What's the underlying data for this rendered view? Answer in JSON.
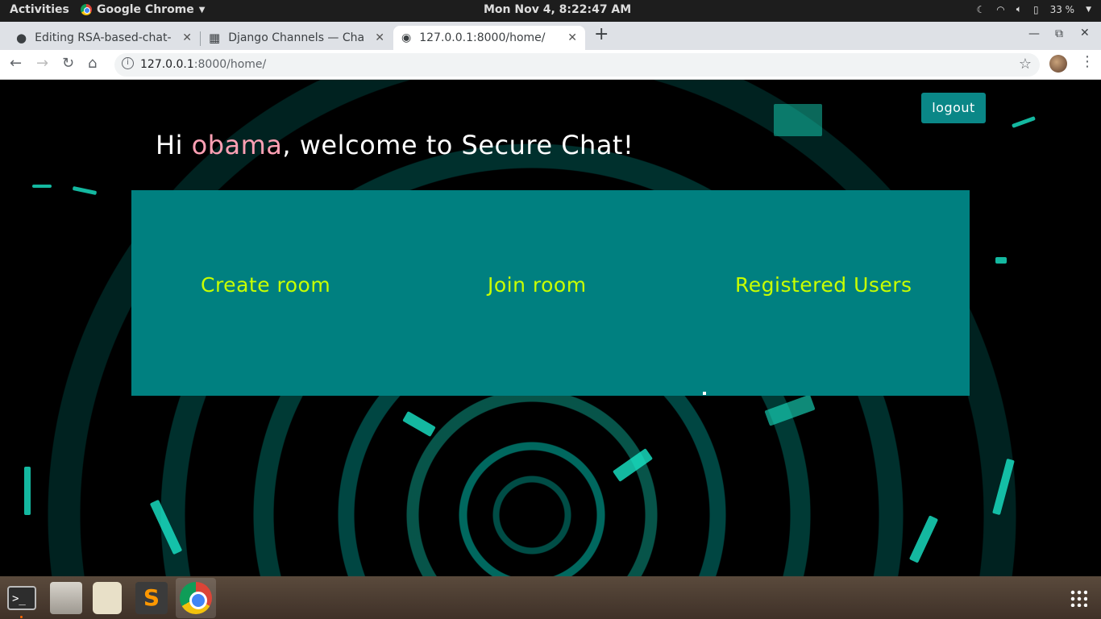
{
  "topbar": {
    "activities": "Activities",
    "app_name": "Google Chrome",
    "clock": "Mon Nov  4,  8:22:47 AM",
    "battery": "33 %"
  },
  "tabs": [
    {
      "title": "Editing RSA-based-chat-ap",
      "icon": "github-icon",
      "active": false
    },
    {
      "title": "Django Channels — Chan",
      "icon": "docs-icon",
      "active": false
    },
    {
      "title": "127.0.0.1:8000/home/",
      "icon": "globe-icon",
      "active": true
    }
  ],
  "address": {
    "host": "127.0.0.1",
    "rest": ":8000/home/"
  },
  "page": {
    "logout_label": "logout",
    "greeting_prefix": "Hi ",
    "username": "obama",
    "greeting_suffix": ", welcome to Secure Chat!",
    "links": {
      "create_room": "Create room",
      "join_room": "Join room",
      "registered_users": "Registered Users"
    },
    "colors": {
      "panel": "#008080",
      "link": "#c8ff00",
      "username": "#ffa0b4",
      "logout_bg": "#0a8787"
    }
  },
  "dock": [
    {
      "name": "terminal-icon"
    },
    {
      "name": "files-icon"
    },
    {
      "name": "music-player-icon"
    },
    {
      "name": "sublime-text-icon"
    },
    {
      "name": "chrome-icon"
    }
  ]
}
